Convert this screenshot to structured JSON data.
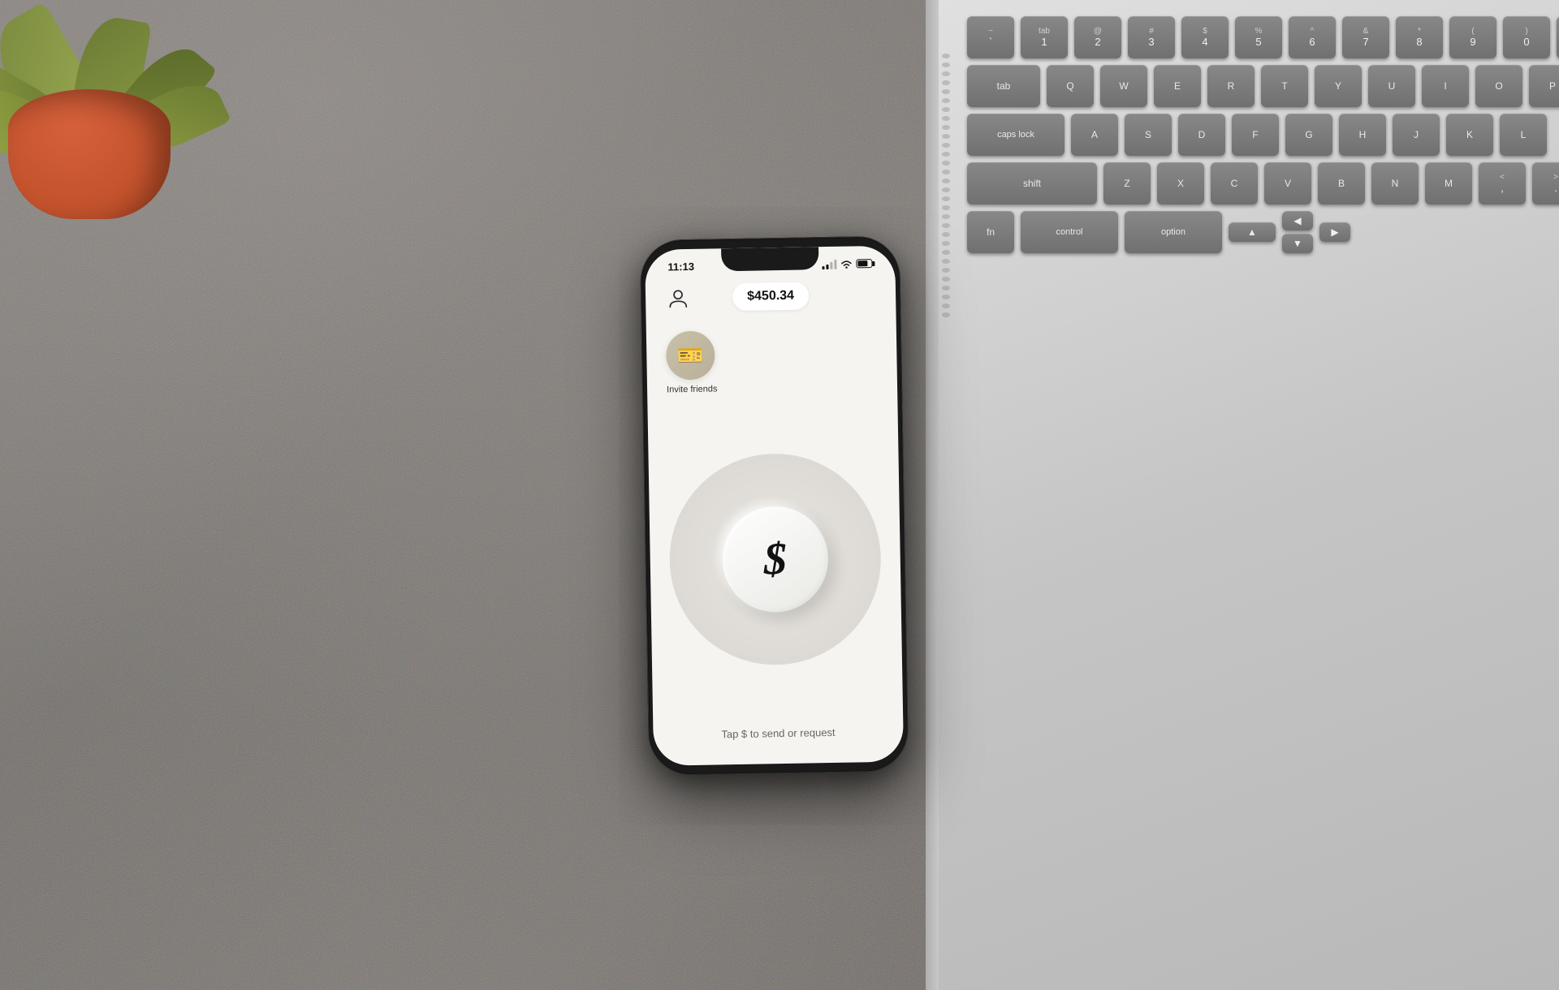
{
  "background": {
    "color": "#7a7570"
  },
  "plant": {
    "alt": "succulent plant in orange pot"
  },
  "laptop": {
    "keys": [
      {
        "row": 0,
        "keys": [
          {
            "id": "backtick",
            "top": "~",
            "bottom": "`"
          },
          {
            "id": "1",
            "top": "!",
            "bottom": "1"
          },
          {
            "id": "2",
            "top": "@",
            "bottom": "2"
          }
        ]
      }
    ],
    "visible_keys": [
      {
        "label": "tab",
        "size": "wide"
      },
      {
        "label": "Q",
        "size": "normal"
      },
      {
        "label": "caps lock",
        "size": "wider"
      },
      {
        "label": "A",
        "size": "normal"
      },
      {
        "label": "shift",
        "size": "widest"
      },
      {
        "label": "Z",
        "size": "normal"
      },
      {
        "label": "fn",
        "size": "normal"
      },
      {
        "label": "control",
        "size": "wide"
      },
      {
        "label": "option",
        "size": "wide"
      }
    ]
  },
  "phone": {
    "status_bar": {
      "time": "11:13",
      "signal": "partial",
      "wifi": true,
      "battery": "75%"
    },
    "app": {
      "balance": "$450.34",
      "invite_label": "Invite friends",
      "dollar_symbol": "$",
      "hint_text": "Tap $ to send or request",
      "profile_icon": "person"
    }
  }
}
